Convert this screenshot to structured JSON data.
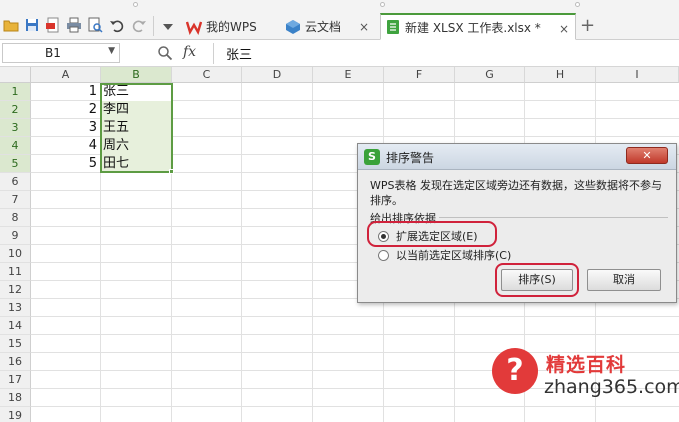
{
  "tabs": [
    {
      "label": "我的WPS"
    },
    {
      "label": "云文档"
    },
    {
      "label": "新建 XLSX 工作表.xlsx *"
    }
  ],
  "tab_close_glyph": "×",
  "new_tab_glyph": "+",
  "formula_bar": {
    "name_box": "B1",
    "fx_label": "fx",
    "content": "张三"
  },
  "sheet": {
    "columns": [
      "A",
      "B",
      "C",
      "D",
      "E",
      "F",
      "G",
      "H",
      "I"
    ],
    "rows": [
      "1",
      "2",
      "3",
      "4",
      "5",
      "6",
      "7",
      "8",
      "9",
      "10",
      "11",
      "12",
      "13",
      "14",
      "15",
      "16",
      "17",
      "18",
      "19"
    ],
    "selected_column": "B",
    "selected_rows": [
      "1",
      "2",
      "3",
      "4",
      "5"
    ],
    "data": [
      {
        "a": "1",
        "b": "张三"
      },
      {
        "a": "2",
        "b": "李四"
      },
      {
        "a": "3",
        "b": "王五"
      },
      {
        "a": "4",
        "b": "周六"
      },
      {
        "a": "5",
        "b": "田七"
      }
    ]
  },
  "dialog": {
    "title": "排序警告",
    "close_label": "✕",
    "message": "WPS表格 发现在选定区域旁边还有数据，这些数据将不参与排序。",
    "group_label": "给出排序依据",
    "option_expand": "扩展选定区域(E)",
    "option_current": "以当前选定区域排序(C)",
    "selected_option": "expand",
    "sort_button": "排序(S)",
    "cancel_button": "取消"
  },
  "watermark": {
    "badge": "?",
    "title": "精选百科",
    "site": "zhang365.com"
  },
  "colors": {
    "accent_green": "#5d9c43",
    "selection_fill": "#e7f0dc",
    "highlight_red": "#d0223b",
    "watermark_red": "#e23a3a"
  }
}
